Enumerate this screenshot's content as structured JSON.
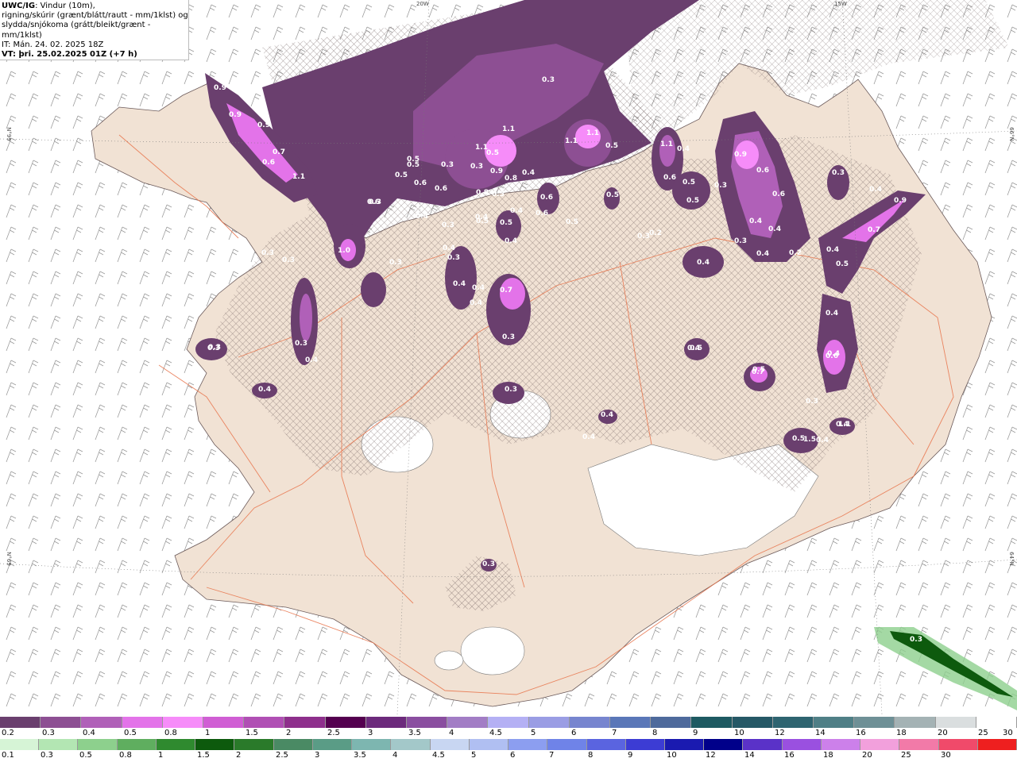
{
  "header": {
    "product_code": "UWC/IG",
    "line1_suffix": ": Vindur (10m),",
    "line2": "rigning/skúrir (grænt/blátt/rautt - mm/1klst) og",
    "line3": "slydda/snjókoma (grátt/bleikt/grænt - mm/1klst)",
    "issue_time": "IT: Mán. 24. 02. 2025 18Z",
    "valid_time": "VT: þri. 25.02.2025 01Z (+7 h)"
  },
  "grid_labels": {
    "top_left": "20W",
    "top_right": "15W",
    "left_upper": "N°99",
    "right_upper": "66°N",
    "left_lower": "N°69",
    "right_lower": "64°N"
  },
  "precip_labels": [
    "0.3",
    "0.9",
    "0.9",
    "0.9",
    "0.7",
    "1.1",
    "0.6",
    "1.0",
    "0.3",
    "0.3",
    "0.3",
    "0.5",
    "0.5",
    "0.3",
    "0.6",
    "0.3",
    "0.4",
    "0.3",
    "0.5",
    "0.6",
    "1.1",
    "0.5",
    "0.3",
    "1.1",
    "0.9",
    "0.8",
    "0.8",
    "0.5",
    "0.4",
    "0.4",
    "0.4",
    "0.5",
    "0.4",
    "0.6",
    "1.1",
    "1.1",
    "0.5",
    "0.5",
    "0.6",
    "0.5",
    "1.1",
    "0.6",
    "0.5",
    "0.5",
    "0.3",
    "0.4",
    "0.9",
    "0.6",
    "0.6",
    "0.4",
    "0.3",
    "0.4",
    "0.4",
    "0.2",
    "0.3",
    "0.9",
    "0.7",
    "0.4",
    "0.5",
    "0.4",
    "0.3",
    "0.6",
    "0.4",
    "0.7",
    "0.3",
    "0.4",
    "0.4",
    "0.3",
    "0.5",
    "0.4",
    "0.4",
    "0.3",
    "0.4",
    "0.5",
    "0.4",
    "0.4",
    "0.3",
    "0.4",
    "0.2",
    "0.3",
    "0.4",
    "0.4",
    "0.3",
    "0.4",
    "0.7",
    "0.3",
    "0.6",
    "0.4",
    "0.3",
    "0.5",
    "0.4",
    "0.5",
    "1.5",
    "1.1",
    "0.3"
  ],
  "snow_scale": {
    "colors": [
      "#6a3f6e",
      "#8d4f93",
      "#b060b8",
      "#e373e9",
      "#f68cf9",
      "#d05ed4",
      "#b04fb4",
      "#8e2f8c",
      "#54004f",
      "#6c2a7c",
      "#8a4ea0",
      "#a27dc5",
      "#b4b0f4",
      "#9a9de4",
      "#7785cf",
      "#5a77b8",
      "#4e6a9c",
      "#1e5a62",
      "#255866",
      "#2e6470",
      "#4f7f86",
      "#6e9096",
      "#a4b2b4",
      "#dadedf",
      "#ffffff"
    ],
    "ticks": [
      "0.2",
      "0.3",
      "0.4",
      "0.5",
      "0.8",
      "1",
      "1.5",
      "2",
      "2.5",
      "3",
      "3.5",
      "4",
      "4.5",
      "5",
      "6",
      "7",
      "8",
      "9",
      "10",
      "12",
      "14",
      "16",
      "18",
      "20",
      "25",
      "30"
    ]
  },
  "rain_scale": {
    "colors": [
      "#d6f4d6",
      "#b3e6b3",
      "#8dd08d",
      "#5fae5f",
      "#2f8a2f",
      "#0d5a0d",
      "#2a7a2a",
      "#4a8a64",
      "#5a9c86",
      "#7db6b0",
      "#a3c8c9",
      "#c8d6f2",
      "#b0bff2",
      "#8c9ef0",
      "#6f83e8",
      "#5a64e0",
      "#3c3cd4",
      "#1a1ab0",
      "#00008a",
      "#5a32c8",
      "#9a50e0",
      "#cc80ea",
      "#f2a0dc",
      "#f27aa8",
      "#f04a6a",
      "#ee1f1f"
    ],
    "ticks": [
      "0.1",
      "0.3",
      "0.5",
      "0.8",
      "1",
      "1.5",
      "2",
      "2.5",
      "3",
      "3.5",
      "4",
      "4.5",
      "5",
      "6",
      "7",
      "8",
      "9",
      "10",
      "12",
      "14",
      "16",
      "18",
      "20",
      "25",
      "30"
    ]
  }
}
